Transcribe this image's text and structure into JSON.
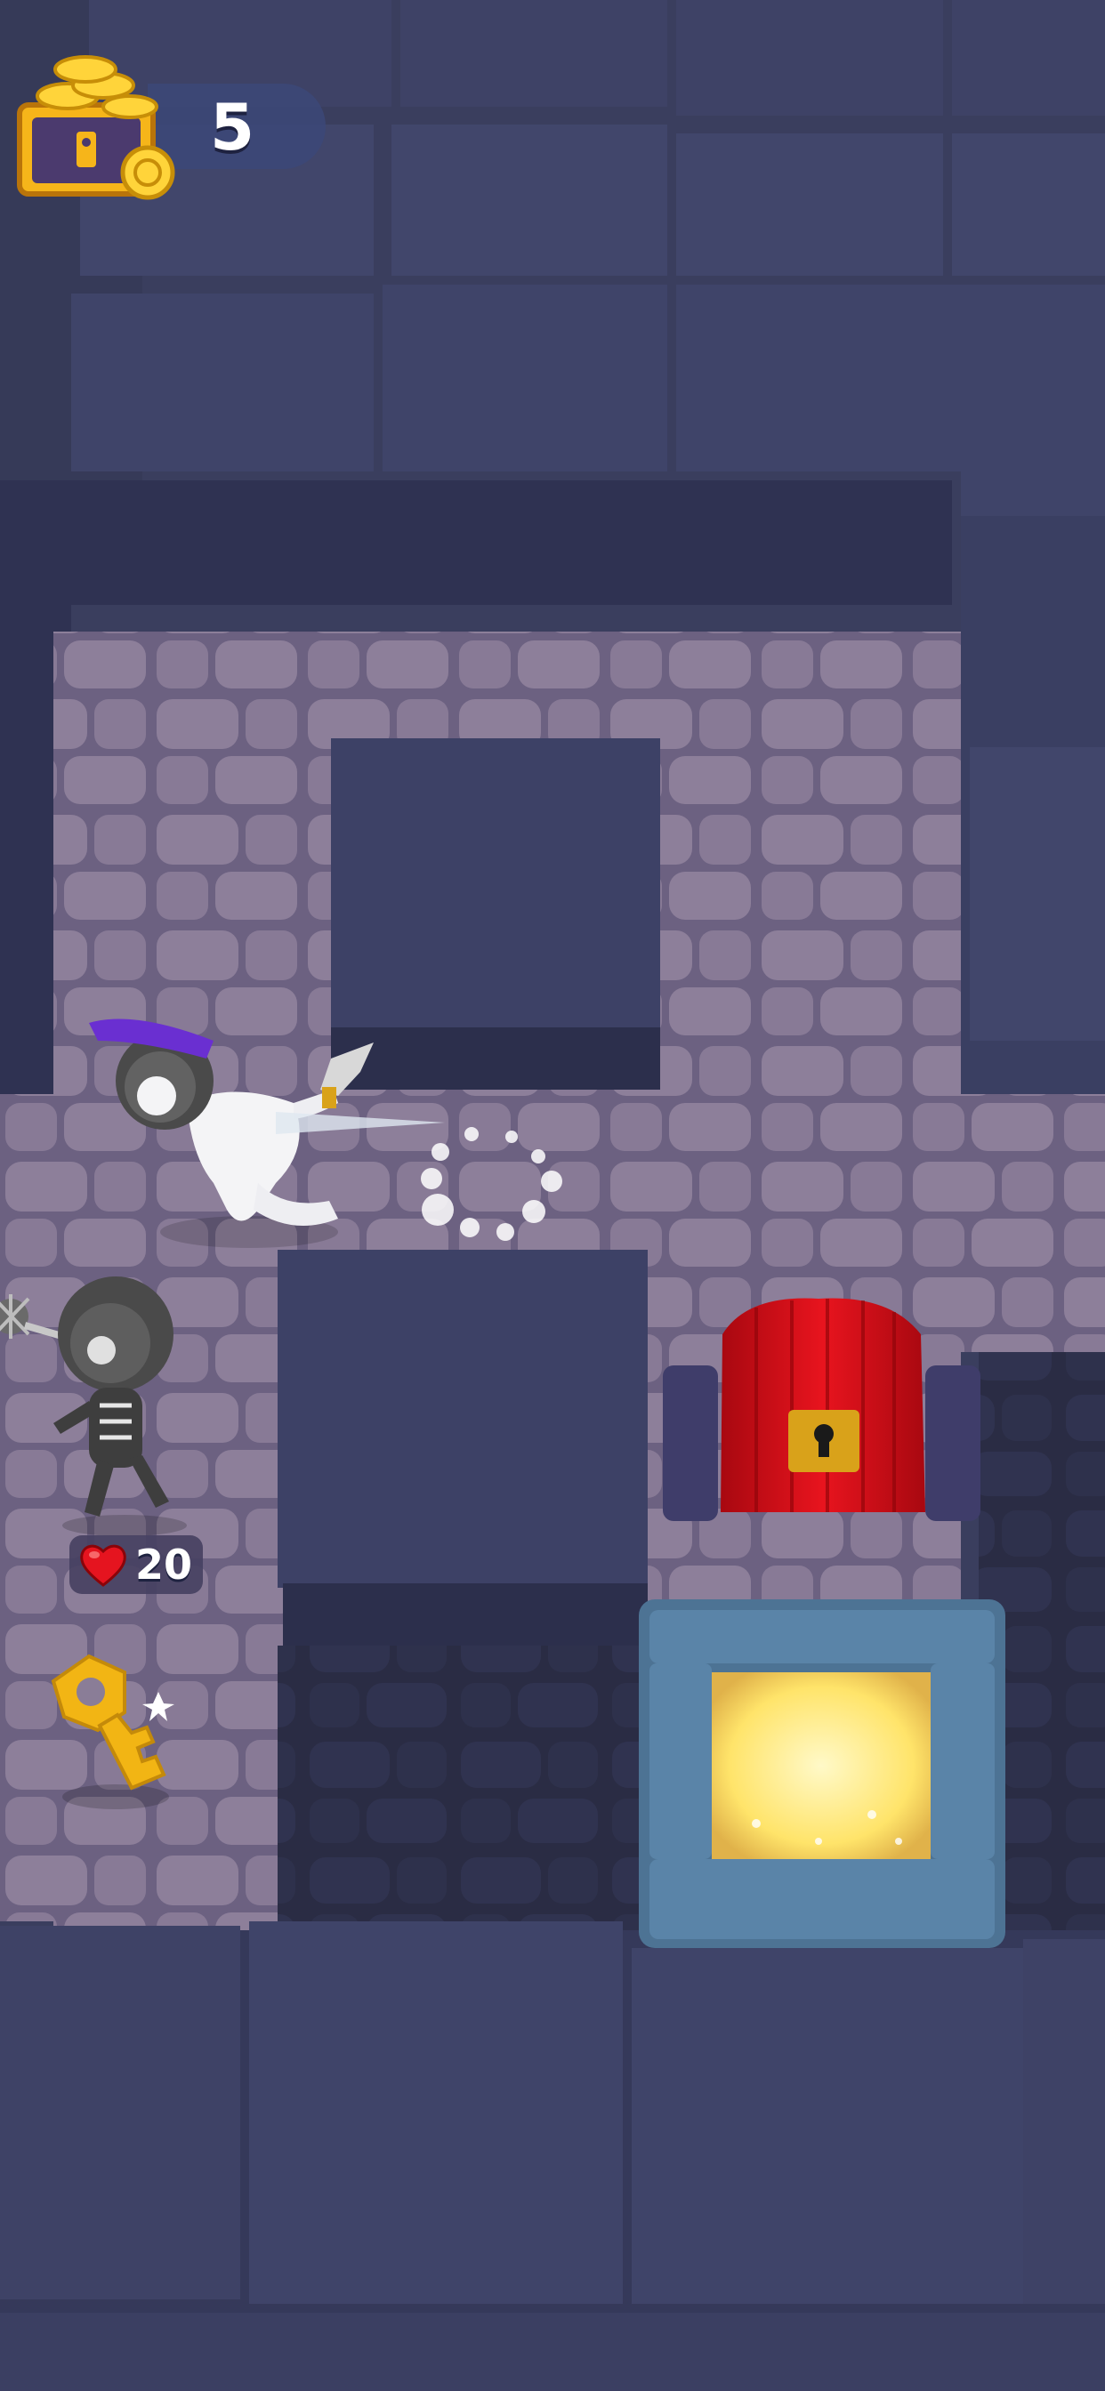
{
  "hud": {
    "coins": "5",
    "coins_icon": "treasure-chest-coins-icon"
  },
  "enemy": {
    "type": "skeleton",
    "health": "20",
    "health_icon": "heart-icon"
  },
  "items": {
    "key_icon": "golden-key-icon",
    "locked_door_icon": "red-locked-door-icon",
    "exit_icon": "glowing-exit-portal-icon"
  },
  "colors": {
    "wall": "#3b3f63",
    "wall_dark": "#2e3150",
    "floor": "#6c6181",
    "floor_stone": "#8d7f9a",
    "door_red": "#d4101a",
    "lock_gold": "#d9a21a",
    "portal_glow": "#fff6a0",
    "portal_frame": "#4d7394",
    "key_gold": "#f2b514",
    "heart_red": "#e5141f"
  }
}
